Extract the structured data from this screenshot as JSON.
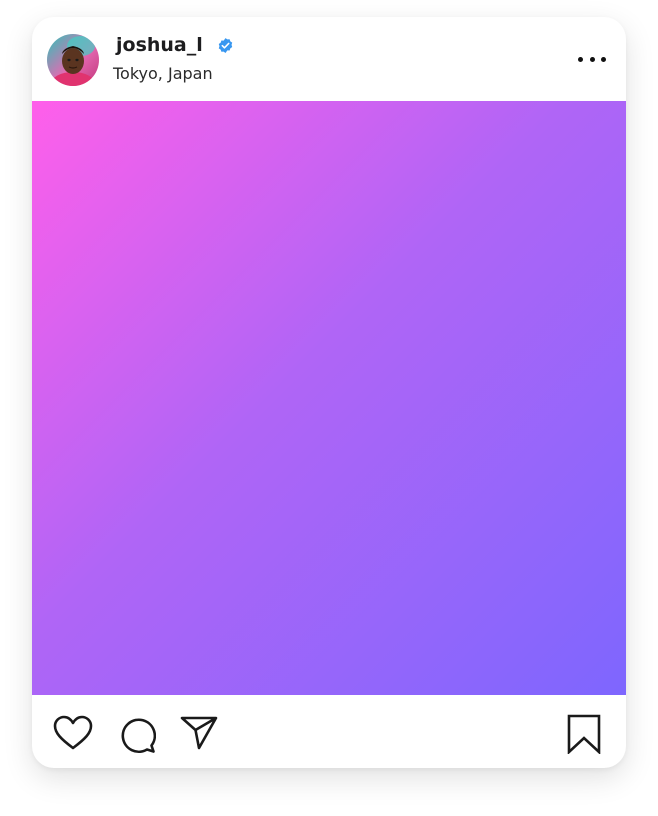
{
  "post": {
    "username": "joshua_l",
    "verified": true,
    "location": "Tokyo, Japan",
    "avatar_icon": "profile-photo",
    "more_icon": "ellipsis-horizontal-icon"
  },
  "media": {
    "gradient_start": "#ff5fea",
    "gradient_end": "#7e66fe"
  },
  "actions": {
    "like_icon": "heart-icon",
    "comment_icon": "comment-bubble-icon",
    "share_icon": "paper-plane-icon",
    "save_icon": "bookmark-icon"
  },
  "colors": {
    "verified_badge": "#3897f0",
    "text": "#1d1d1f"
  }
}
